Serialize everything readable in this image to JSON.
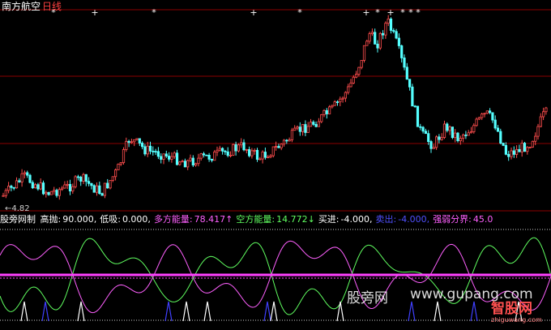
{
  "header": {
    "stock_name": "南方航空",
    "period": "日线"
  },
  "price_low_label": "←4.82",
  "indicator": {
    "name": "股旁网制",
    "items": [
      {
        "label": "高抛:",
        "value": "90.000,",
        "color": "#ffffff"
      },
      {
        "label": "低吸:",
        "value": "0.000,",
        "color": "#ffffff"
      },
      {
        "label": "多方能量:",
        "value": "78.417↑",
        "color": "#ff60ff"
      },
      {
        "label": "空方能量:",
        "value": "14.772↓",
        "color": "#60ff60"
      },
      {
        "label": "买进:",
        "value": "-4.000,",
        "color": "#ffffff"
      },
      {
        "label": "卖出:",
        "value": "-4.000,",
        "color": "#5050ff"
      },
      {
        "label": "强弱分界:",
        "value": "45.0",
        "color": "#ff60ff"
      }
    ]
  },
  "watermark": {
    "text1": "股旁网",
    "text2": "www.gupang.com",
    "logo_text": "智股网",
    "logo_url": "zhiguwang.com"
  },
  "colors": {
    "up": "#ff4d4d",
    "down": "#54ffff",
    "grid": "#8b0000",
    "bull": "#ff60ff",
    "bear": "#60ff60",
    "band": "#ff40ff"
  }
}
